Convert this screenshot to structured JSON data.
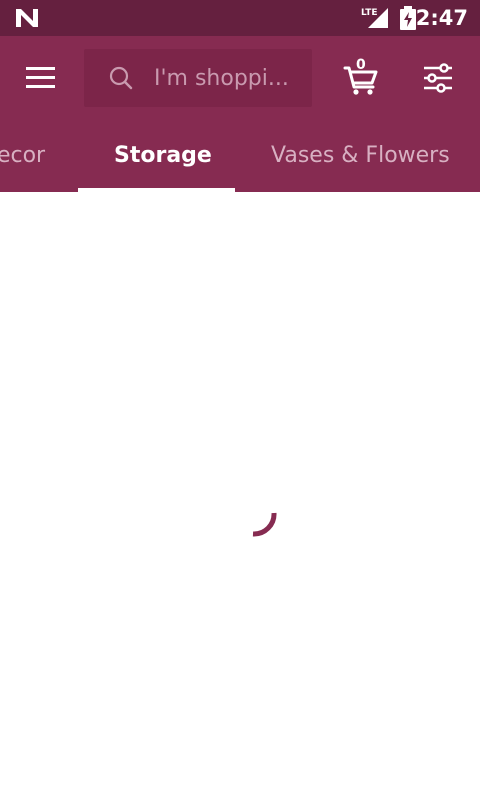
{
  "status_bar": {
    "time": "2:47",
    "network": "LTE"
  },
  "toolbar": {
    "search_placeholder": "I'm shoppi...",
    "cart_count": "0"
  },
  "tabs": [
    {
      "label": "Decor",
      "active": false
    },
    {
      "label": "Storage",
      "active": true
    },
    {
      "label": "Vases & Flowers",
      "active": false
    }
  ],
  "colors": {
    "status_bar": "#65203f",
    "primary": "#862b51",
    "search_box": "#7c2549",
    "spinner": "#862b51"
  },
  "icons": {
    "menu": "hamburger-menu-icon",
    "search": "search-icon",
    "cart": "shopping-cart-icon",
    "filter": "filter-sliders-icon"
  }
}
